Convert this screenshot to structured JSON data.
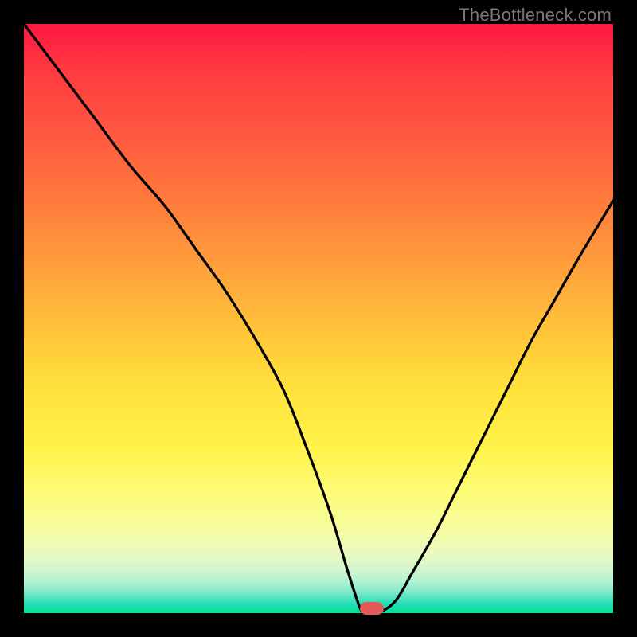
{
  "attribution": "TheBottleneck.com",
  "chart_data": {
    "type": "line",
    "title": "",
    "xlabel": "",
    "ylabel": "",
    "xlim": [
      0,
      100
    ],
    "ylim": [
      0,
      100
    ],
    "series": [
      {
        "name": "bottleneck-curve",
        "x": [
          0,
          6,
          12,
          18,
          24,
          29,
          34,
          39,
          44,
          48,
          52,
          55,
          57,
          58,
          60,
          63,
          66,
          70,
          74,
          78,
          82,
          86,
          90,
          94,
          100
        ],
        "values": [
          100,
          92,
          84,
          76,
          69,
          62,
          55,
          47,
          38,
          28,
          17,
          7,
          1,
          0,
          0,
          2,
          7,
          14,
          22,
          30,
          38,
          46,
          53,
          60,
          70
        ]
      }
    ],
    "marker": {
      "x": 59,
      "y": 0
    },
    "gradient_stops": [
      {
        "pos": 0,
        "color": "#ff1744"
      },
      {
        "pos": 8,
        "color": "#ff3b3f"
      },
      {
        "pos": 18,
        "color": "#ff5640"
      },
      {
        "pos": 30,
        "color": "#ff7a3d"
      },
      {
        "pos": 42,
        "color": "#ffa23c"
      },
      {
        "pos": 52,
        "color": "#ffc43a"
      },
      {
        "pos": 62,
        "color": "#ffe23b"
      },
      {
        "pos": 72,
        "color": "#fff24a"
      },
      {
        "pos": 80,
        "color": "#fdfd7a"
      },
      {
        "pos": 86,
        "color": "#f6fba1"
      },
      {
        "pos": 90,
        "color": "#e9f9c1"
      },
      {
        "pos": 93,
        "color": "#d0f5cf"
      },
      {
        "pos": 95,
        "color": "#a8f0d0"
      },
      {
        "pos": 96.5,
        "color": "#7ce9c8"
      },
      {
        "pos": 97.5,
        "color": "#4fe2bf"
      },
      {
        "pos": 98.5,
        "color": "#22dcb5"
      },
      {
        "pos": 100,
        "color": "#00e490"
      }
    ]
  }
}
